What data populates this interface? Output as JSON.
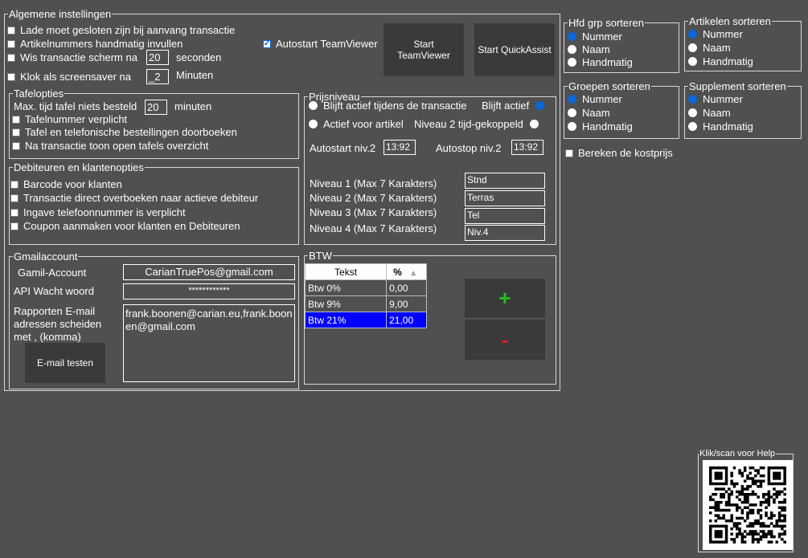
{
  "general": {
    "title": "Algemene instellingen",
    "lade": "Lade moet gesloten zijn bij aanvang transactie",
    "artikelnummers": "Artikelnummers handmatig invullen",
    "wis_pre": "Wis transactie scherm na",
    "wis_value": "20",
    "wis_post": "seconden",
    "klok_pre": "Klok als screensaver na",
    "klok_value": "_2",
    "klok_post": "Minuten",
    "autostart_tv": "Autostart TeamViewer",
    "start_tv_line1": "Start",
    "start_tv_line2": "TeamViewer",
    "start_qa": "Start QuickAssist"
  },
  "tafel": {
    "title": "Tafelopties",
    "max_pre": "Max. tijd tafel niets besteld",
    "max_value": "20",
    "max_post": "minuten",
    "verplicht": "Tafelnummer verplicht",
    "doorboeken": "Tafel en telefonische bestellingen doorboeken",
    "overzicht": "Na transactie toon open tafels overzicht"
  },
  "debiteuren": {
    "title": "Debiteuren en klantenopties",
    "barcode": "Barcode voor klanten",
    "direct": "Transactie direct  overboeken naar actieve debiteur",
    "telefoon": "Ingave telefoonnummer is verplicht",
    "coupon": "Coupon aanmaken voor klanten en Debiteuren"
  },
  "gmail": {
    "title": "Gmailaccount",
    "account_label": "Gamil-Account",
    "account_value": "CarianTruePos@gmail.com",
    "api_label": "API Wacht woord",
    "api_value": "************",
    "rapport_line1": "Rapporten E-mail",
    "rapport_line2": "adressen scheiden",
    "rapport_line3": "met , (komma)",
    "emails": "frank.boonen@carian.eu,frank.boonen@gmail.com",
    "test_button": "E-mail testen"
  },
  "prijs": {
    "title": "Prijsniveau",
    "blijft_actief_tijdens": "Blijft actief tijdens de transactie",
    "blijft_actief": "Blijft actief",
    "actief_artikel": "Actief voor artikel",
    "niveau2_tijd": "Niveau 2 tijd-gekoppeld",
    "autostart_label": "Autostart niv.2",
    "autostart_value": "13:92",
    "autostop_label": "Autostop niv.2",
    "autostop_value": "13:92",
    "levels": [
      {
        "label": "Niveau 1 (Max 7 Karakters)",
        "value": "Stnd"
      },
      {
        "label": "Niveau 2 (Max 7 Karakters)",
        "value": "Terras"
      },
      {
        "label": "Niveau 3 (Max 7 Karakters)",
        "value": "Tel"
      },
      {
        "label": "Niveau 4 (Max 7 Karakters)",
        "value": "Niv.4"
      }
    ]
  },
  "btw": {
    "title": "BTW",
    "col_tekst": "Tekst",
    "col_pct": "%",
    "sort_glyph": "▵",
    "rows": [
      {
        "tekst": "Btw 0%",
        "pct": "0,00"
      },
      {
        "tekst": "Btw  9%",
        "pct": "9,00"
      },
      {
        "tekst": "Btw 21%",
        "pct": "21,00"
      }
    ],
    "plus": "+",
    "minus": "-"
  },
  "sort": {
    "hfd_title": "Hfd grp sorteren",
    "art_title": "Artikelen sorteren",
    "groep_title": "Groepen sorteren",
    "supp_title": "Supplement sorteren",
    "opt_nummer": "Nummer",
    "opt_naam": "Naam",
    "opt_handmatig": "Handmatig"
  },
  "kostprijs": "Bereken de kostprijs",
  "help": {
    "title": "Klik/scan voor Help"
  },
  "colors": {
    "accent": "#0a64d8",
    "selected_row": "#0000ff",
    "plus": "#22c022",
    "minus": "#e02020"
  }
}
